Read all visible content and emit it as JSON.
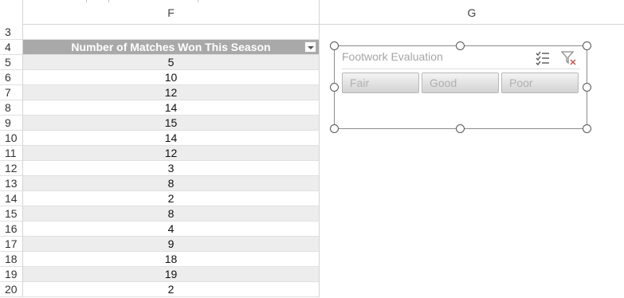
{
  "columns": {
    "f": "F",
    "g": "G"
  },
  "header_row": {
    "num": "4",
    "label": "Number of Matches Won This Season"
  },
  "row3": {
    "num": "3"
  },
  "rows": [
    {
      "num": "5",
      "value": "5"
    },
    {
      "num": "6",
      "value": "10"
    },
    {
      "num": "7",
      "value": "12"
    },
    {
      "num": "8",
      "value": "14"
    },
    {
      "num": "9",
      "value": "15"
    },
    {
      "num": "10",
      "value": "14"
    },
    {
      "num": "11",
      "value": "12"
    },
    {
      "num": "12",
      "value": "3"
    },
    {
      "num": "13",
      "value": "8"
    },
    {
      "num": "14",
      "value": "2"
    },
    {
      "num": "15",
      "value": "8"
    },
    {
      "num": "16",
      "value": "4"
    },
    {
      "num": "17",
      "value": "9"
    },
    {
      "num": "18",
      "value": "18"
    },
    {
      "num": "19",
      "value": "19"
    },
    {
      "num": "20",
      "value": "2"
    }
  ],
  "slicer": {
    "title": "Footwork Evaluation",
    "items": [
      "Fair",
      "Good",
      "Poor"
    ],
    "multi_select_icon": "multi-select-icon",
    "clear_filter_icon": "clear-filter-icon"
  },
  "colors": {
    "header_fill": "#a9a9a9",
    "band_fill": "#ededed",
    "gridline": "#d4d4d4"
  }
}
